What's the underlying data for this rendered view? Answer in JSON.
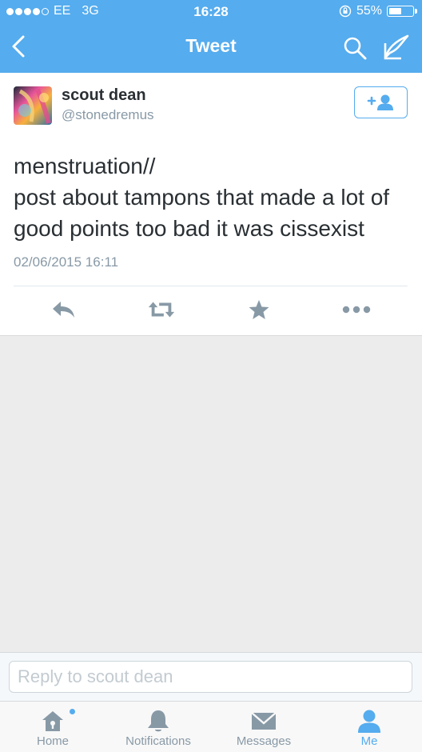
{
  "status_bar": {
    "carrier": "EE",
    "network": "3G",
    "time": "16:28",
    "battery": "55%",
    "battery_level": 0.55,
    "signal_bars_filled": 4,
    "signal_bars_total": 5
  },
  "nav": {
    "title": "Tweet",
    "back_icon": "chevron-left-icon",
    "search_icon": "search-icon",
    "compose_icon": "compose-icon"
  },
  "tweet": {
    "author_name": "scout dean",
    "author_handle": "@stonedremus",
    "text_lines": [
      "menstruation//",
      "post about tampons that made a lot of",
      "good points too bad it was cissexist"
    ],
    "timestamp": "02/06/2015 16:11",
    "follow_icon": "add-user-icon",
    "actions": [
      "reply-icon",
      "retweet-icon",
      "favorite-icon",
      "more-icon"
    ]
  },
  "reply": {
    "placeholder": "Reply to scout dean"
  },
  "tabbar": {
    "tabs": [
      {
        "label": "Home",
        "icon": "home-icon"
      },
      {
        "label": "Notifications",
        "icon": "bell-icon"
      },
      {
        "label": "Messages",
        "icon": "envelope-icon"
      },
      {
        "label": "Me",
        "icon": "person-icon"
      }
    ],
    "active_tab": "Me"
  },
  "colors": {
    "brand": "#55acee",
    "background": "#ececed",
    "text": "#292f33",
    "muted": "#8899a6",
    "action_icons": "#8899a6"
  }
}
